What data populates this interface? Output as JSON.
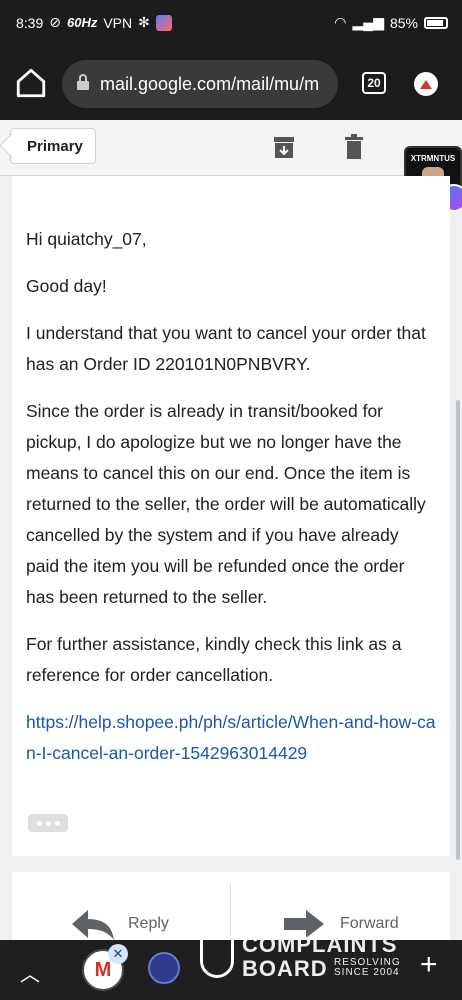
{
  "status_bar": {
    "time": "8:39",
    "refresh_rate": "60Hz",
    "vpn": "VPN",
    "battery": "85%"
  },
  "browser": {
    "url": "mail.google.com/mail/mu/m",
    "tab_count": "20"
  },
  "mail_toolbar": {
    "primary_label": "Primary"
  },
  "chat_head": {
    "label": "XTRMNTUS"
  },
  "email": {
    "greeting": "Hi quiatchy_07,",
    "salutation": "Good day!",
    "paragraph1": "I understand that you want to cancel your order that has an Order ID 220101N0PNBVRY.",
    "paragraph2": "Since the order is already in transit/booked for pickup, I do apologize but we no longer have the means to cancel this on our end. Once the item is returned to the seller, the order will be automatically cancelled by the system and if you have already paid the item you will be refunded once the order has been returned to the seller.",
    "paragraph3": "For further assistance, kindly check this link as a reference for order cancellation.",
    "link": "https://help.shopee.ph/ph/s/article/When-and-how-can-I-cancel-an-order-1542963014429"
  },
  "actions": {
    "reply": "Reply",
    "forward": "Forward"
  },
  "watermark": {
    "line1": "COMPLAINTS",
    "line2": "BOARD",
    "sub1": "RESOLVING",
    "sub2": "SINCE 2004"
  }
}
